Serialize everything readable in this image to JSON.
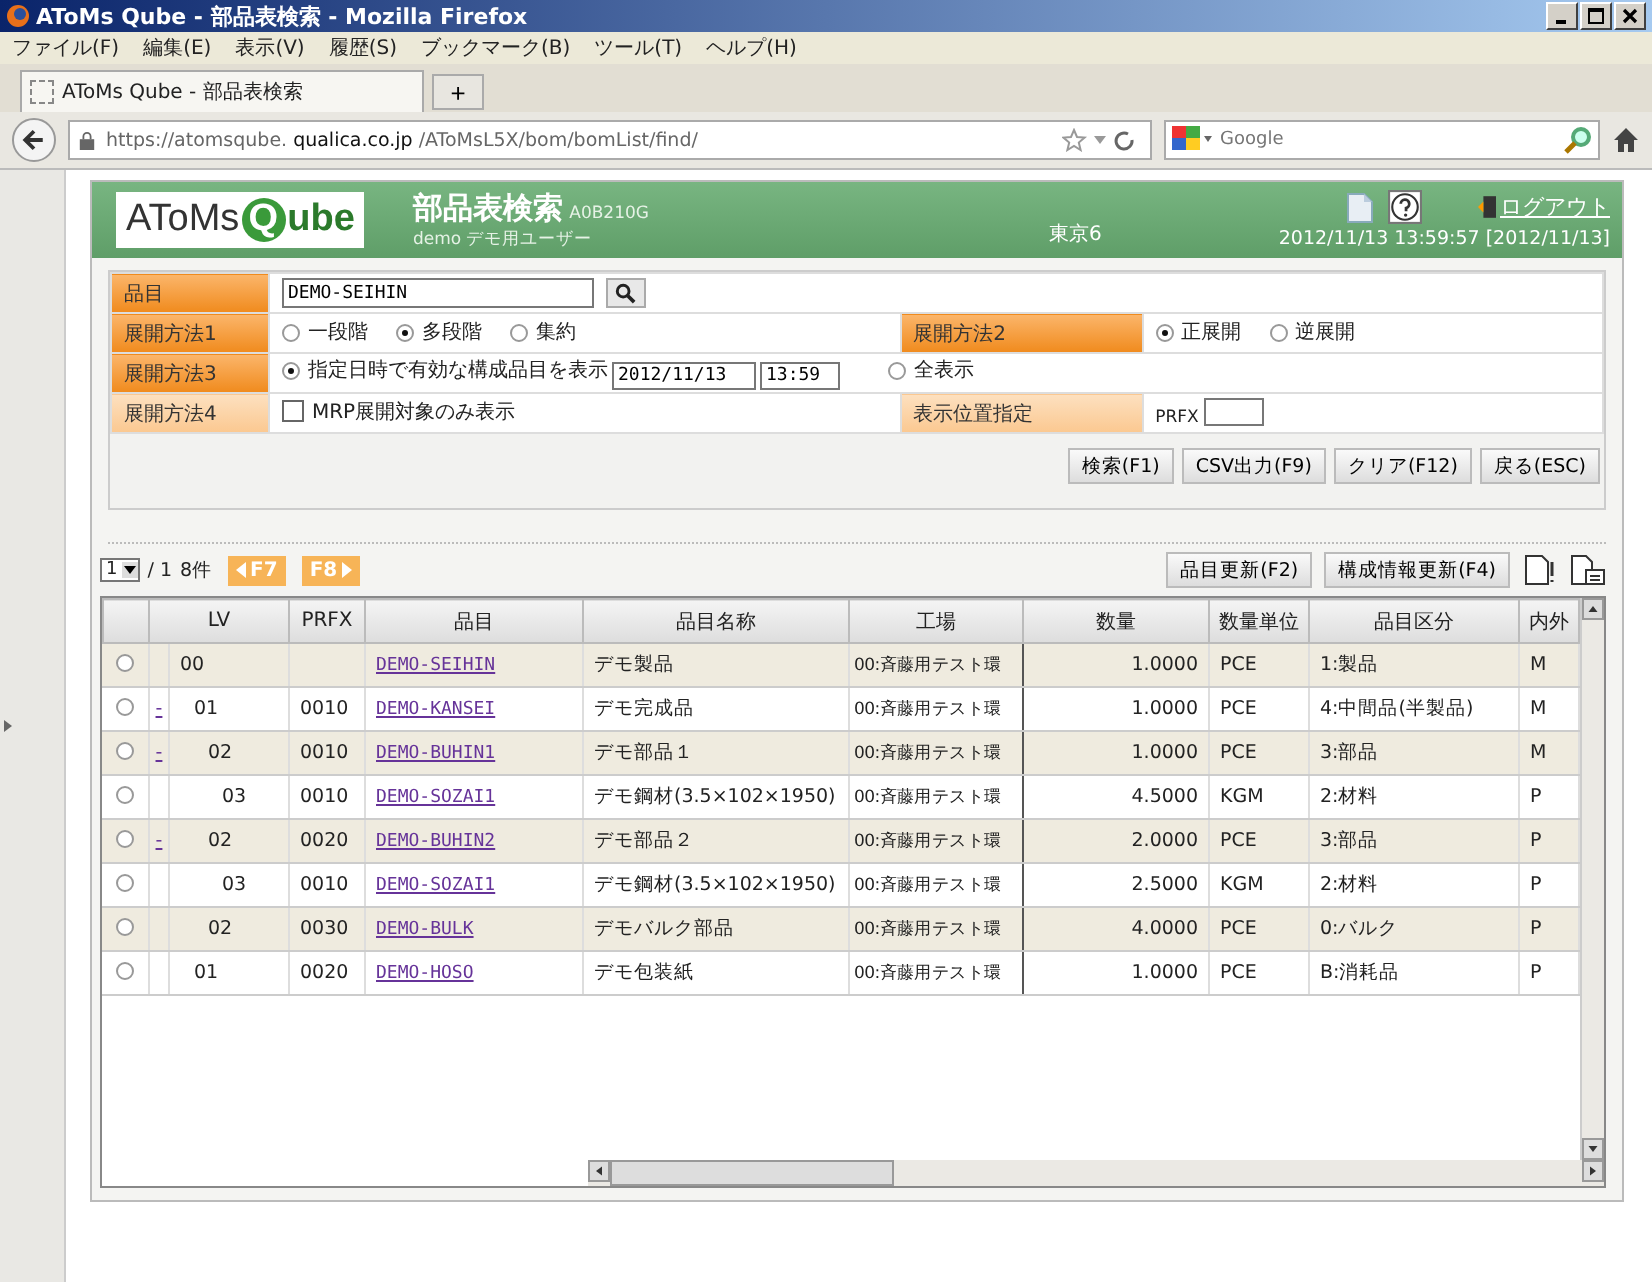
{
  "window": {
    "title": "AToMs Qube - 部品表検索 - Mozilla Firefox"
  },
  "menu": [
    "ファイル(F)",
    "編集(E)",
    "表示(V)",
    "履歴(S)",
    "ブックマーク(B)",
    "ツール(T)",
    "ヘルプ(H)"
  ],
  "tabs": [
    {
      "label": "AToMs Qube - 部品表検索"
    }
  ],
  "tab_add": "+",
  "address": {
    "prefix": "https://atomsqube.",
    "host": "qualica.co.jp",
    "path": "/AToMsL5X/bom/bomList/find/"
  },
  "search": {
    "placeholder": "Google"
  },
  "header": {
    "logo_a": "AToMs",
    "logo_q": "Q",
    "logo_b": "ube",
    "title": "部品表検索",
    "code": "A0B210G",
    "user": "demo デモ用ユーザー",
    "site": "東京6",
    "datetime": "2012/11/13 13:59:57 [2012/11/13]",
    "logout": "ログアウト"
  },
  "form": {
    "item_label": "品目",
    "item_value": "DEMO-SEIHIN",
    "method1_label": "展開方法1",
    "method1_options": [
      {
        "label": "一段階",
        "selected": false
      },
      {
        "label": "多段階",
        "selected": true
      },
      {
        "label": "集約",
        "selected": false
      }
    ],
    "method2_label": "展開方法2",
    "method2_options": [
      {
        "label": "正展開",
        "selected": true
      },
      {
        "label": "逆展開",
        "selected": false
      }
    ],
    "method3_label": "展開方法3",
    "method3_options": [
      {
        "label": "指定日時で有効な構成品目を表示",
        "selected": true
      },
      {
        "label": "全表示",
        "selected": false
      }
    ],
    "date": "2012/11/13",
    "time": "13:59",
    "method4_label": "展開方法4",
    "mrp_label": "MRP展開対象のみ表示",
    "mrp_checked": false,
    "position_label": "表示位置指定",
    "prfx_label": "PRFX",
    "buttons": [
      "検索(F1)",
      "CSV出力(F9)",
      "クリア(F12)",
      "戻る(ESC)"
    ]
  },
  "pager": {
    "page": "1",
    "total": "/ 1",
    "count": "8件",
    "prev": "F7",
    "next": "F8"
  },
  "actions": [
    "品目更新(F2)",
    "構成情報更新(F4)"
  ],
  "table": {
    "columns": [
      "LV",
      "PRFX",
      "品目",
      "品目名称",
      "工場",
      "数量",
      "数量単位",
      "品目区分",
      "内外"
    ],
    "rows": [
      {
        "selected": false,
        "lv": "00",
        "prfx": "",
        "item": "DEMO-SEIHIN",
        "name": "デモ製品",
        "plant": "00:斉藤用テスト環",
        "qty": "1.0000",
        "unit": "PCE",
        "category": "1:製品",
        "inout": "M",
        "children": [
          {
            "selected": false,
            "expander": "-",
            "lv": "01",
            "prfx": "0010",
            "item": "DEMO-KANSEI",
            "name": "デモ完成品",
            "plant": "00:斉藤用テスト環",
            "qty": "1.0000",
            "unit": "PCE",
            "category": "4:中間品(半製品)",
            "inout": "M",
            "children": [
              {
                "selected": false,
                "expander": "-",
                "lv": "02",
                "prfx": "0010",
                "item": "DEMO-BUHIN1",
                "name": "デモ部品１",
                "plant": "00:斉藤用テスト環",
                "qty": "1.0000",
                "unit": "PCE",
                "category": "3:部品",
                "inout": "M",
                "children": [
                  {
                    "selected": false,
                    "lv": "03",
                    "prfx": "0010",
                    "item": "DEMO-SOZAI1",
                    "name": "デモ鋼材(3.5×102×1950)",
                    "plant": "00:斉藤用テスト環",
                    "qty": "4.5000",
                    "unit": "KGM",
                    "category": "2:材料",
                    "inout": "P"
                  }
                ]
              },
              {
                "selected": false,
                "expander": "-",
                "lv": "02",
                "prfx": "0020",
                "item": "DEMO-BUHIN2",
                "name": "デモ部品２",
                "plant": "00:斉藤用テスト環",
                "qty": "2.0000",
                "unit": "PCE",
                "category": "3:部品",
                "inout": "P",
                "children": [
                  {
                    "selected": false,
                    "lv": "03",
                    "prfx": "0010",
                    "item": "DEMO-SOZAI1",
                    "name": "デモ鋼材(3.5×102×1950)",
                    "plant": "00:斉藤用テスト環",
                    "qty": "2.5000",
                    "unit": "KGM",
                    "category": "2:材料",
                    "inout": "P"
                  }
                ]
              },
              {
                "selected": false,
                "lv": "02",
                "prfx": "0030",
                "item": "DEMO-BULK",
                "name": "デモバルク部品",
                "plant": "00:斉藤用テスト環",
                "qty": "4.0000",
                "unit": "PCE",
                "category": "0:バルク",
                "inout": "P"
              }
            ]
          },
          {
            "selected": false,
            "lv": "01",
            "prfx": "0020",
            "item": "DEMO-HOSO",
            "name": "デモ包装紙",
            "plant": "00:斉藤用テスト環",
            "qty": "1.0000",
            "unit": "PCE",
            "category": "B:消耗品",
            "inout": "P"
          }
        ]
      }
    ]
  }
}
